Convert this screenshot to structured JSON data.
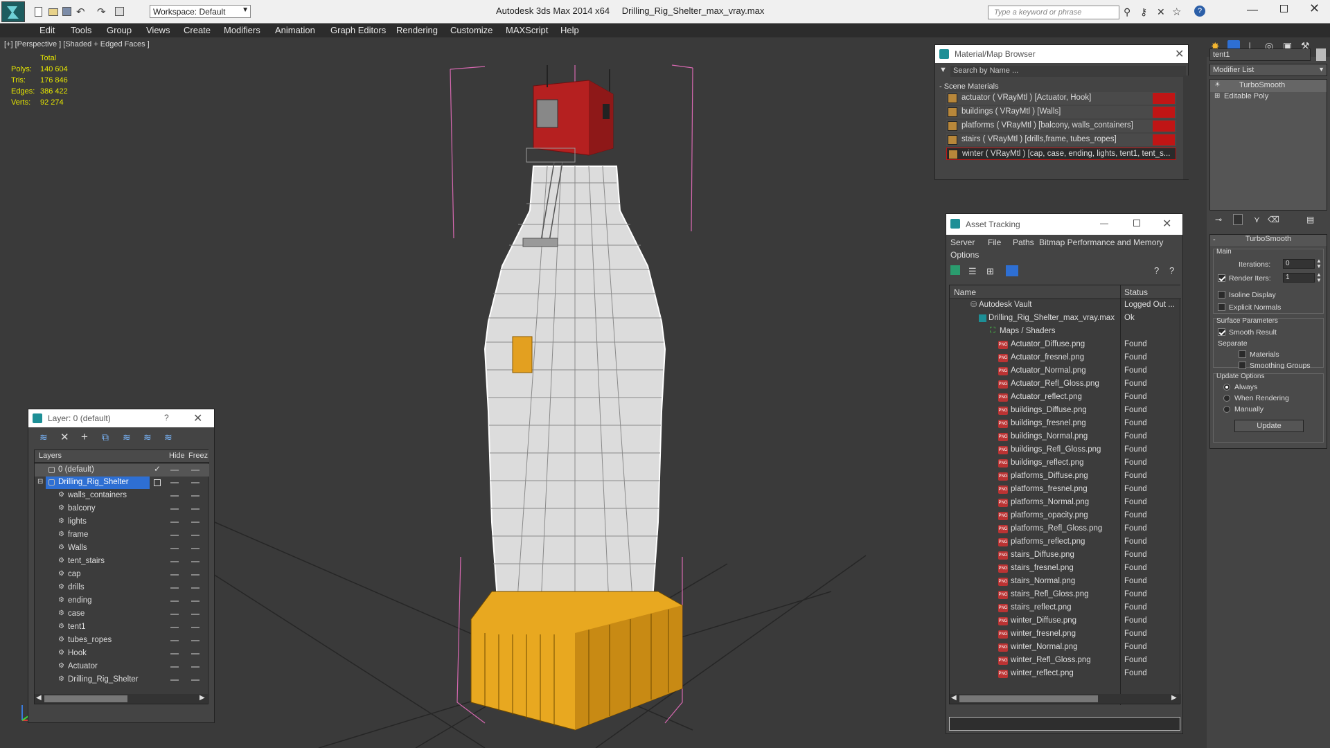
{
  "titlebar": {
    "workspace": "Workspace: Default",
    "app_title": "Autodesk 3ds Max  2014 x64",
    "file_title": "Drilling_Rig_Shelter_max_vray.max",
    "search_placeholder": "Type a keyword or phrase"
  },
  "menus": [
    "Edit",
    "Tools",
    "Group",
    "Views",
    "Create",
    "Modifiers",
    "Animation",
    "Graph Editors",
    "Rendering",
    "Customize",
    "MAXScript",
    "Help"
  ],
  "viewport": {
    "label": "[+] [Perspective ] [Shaded + Edged Faces ]",
    "stats": {
      "header": "Total",
      "polys_label": "Polys:",
      "polys": "140 604",
      "tris_label": "Tris:",
      "tris": "176 846",
      "edges_label": "Edges:",
      "edges": "386 422",
      "verts_label": "Verts:",
      "verts": "92 274"
    }
  },
  "material_browser": {
    "title": "Material/Map Browser",
    "search_placeholder": "Search by Name ...",
    "section": "- Scene Materials",
    "items": [
      "actuator  ( VRayMtl ) [Actuator, Hook]",
      "buildings  ( VRayMtl ) [Walls]",
      "platforms  ( VRayMtl ) [balcony, walls_containers]",
      "stairs  ( VRayMtl ) [drills,frame, tubes_ropes]",
      "winter  ( VRayMtl ) [cap, case, ending, lights, tent1, tent_s..."
    ]
  },
  "asset_tracking": {
    "title": "Asset Tracking",
    "menu": [
      "Server",
      "File",
      "Paths",
      "Bitmap Performance and Memory",
      "Options"
    ],
    "col_name": "Name",
    "col_status": "Status",
    "vault": {
      "name": "Autodesk Vault",
      "status": "Logged Out ..."
    },
    "file": {
      "name": "Drilling_Rig_Shelter_max_vray.max",
      "status": "Ok"
    },
    "maps_folder": "Maps / Shaders",
    "png_tag": "PNG",
    "found": "Found",
    "maps": [
      "Actuator_Diffuse.png",
      "Actuator_fresnel.png",
      "Actuator_Normal.png",
      "Actuator_Refl_Gloss.png",
      "Actuator_reflect.png",
      "buildings_Diffuse.png",
      "buildings_fresnel.png",
      "buildings_Normal.png",
      "buildings_Refl_Gloss.png",
      "buildings_reflect.png",
      "platforms_Diffuse.png",
      "platforms_fresnel.png",
      "platforms_Normal.png",
      "platforms_opacity.png",
      "platforms_Refl_Gloss.png",
      "platforms_reflect.png",
      "stairs_Diffuse.png",
      "stairs_fresnel.png",
      "stairs_Normal.png",
      "stairs_Refl_Gloss.png",
      "stairs_reflect.png",
      "winter_Diffuse.png",
      "winter_fresnel.png",
      "winter_Normal.png",
      "winter_Refl_Gloss.png",
      "winter_reflect.png"
    ]
  },
  "layer_panel": {
    "title": "Layer: 0 (default)",
    "help": "?",
    "col_layers": "Layers",
    "col_hide": "Hide",
    "col_freeze": "Freez",
    "default_layer": "0 (default)",
    "rig_layer": "Drilling_Rig_Shelter",
    "objects": [
      "walls_containers",
      "balcony",
      "lights",
      "frame",
      "Walls",
      "tent_stairs",
      "cap",
      "drills",
      "ending",
      "case",
      "tent1",
      "tubes_ropes",
      "Hook",
      "Actuator",
      "Drilling_Rig_Shelter"
    ]
  },
  "command_panel": {
    "object_name": "tent1",
    "modifier_list": "Modifier List",
    "stack": [
      "TurboSmooth",
      "Editable Poly"
    ],
    "rollout_title": "TurboSmooth",
    "main_group": "Main",
    "iterations_label": "Iterations:",
    "iterations_value": "0",
    "render_iters_label": "Render Iters:",
    "render_iters_value": "1",
    "isoline": "Isoline Display",
    "explicit_normals": "Explicit Normals",
    "surface_group": "Surface Parameters",
    "smooth_result": "Smooth Result",
    "separate": "Separate",
    "materials": "Materials",
    "smoothing_groups": "Smoothing Groups",
    "update_group": "Update Options",
    "always": "Always",
    "when_rendering": "When Rendering",
    "manually": "Manually",
    "update_button": "Update"
  },
  "colors": {
    "accent_red": "#c01515",
    "selection_blue": "#2e6fd3",
    "viewport_bg": "#3a3a3a",
    "base_yellow": "#e8a820",
    "cabin_red": "#b52020"
  }
}
